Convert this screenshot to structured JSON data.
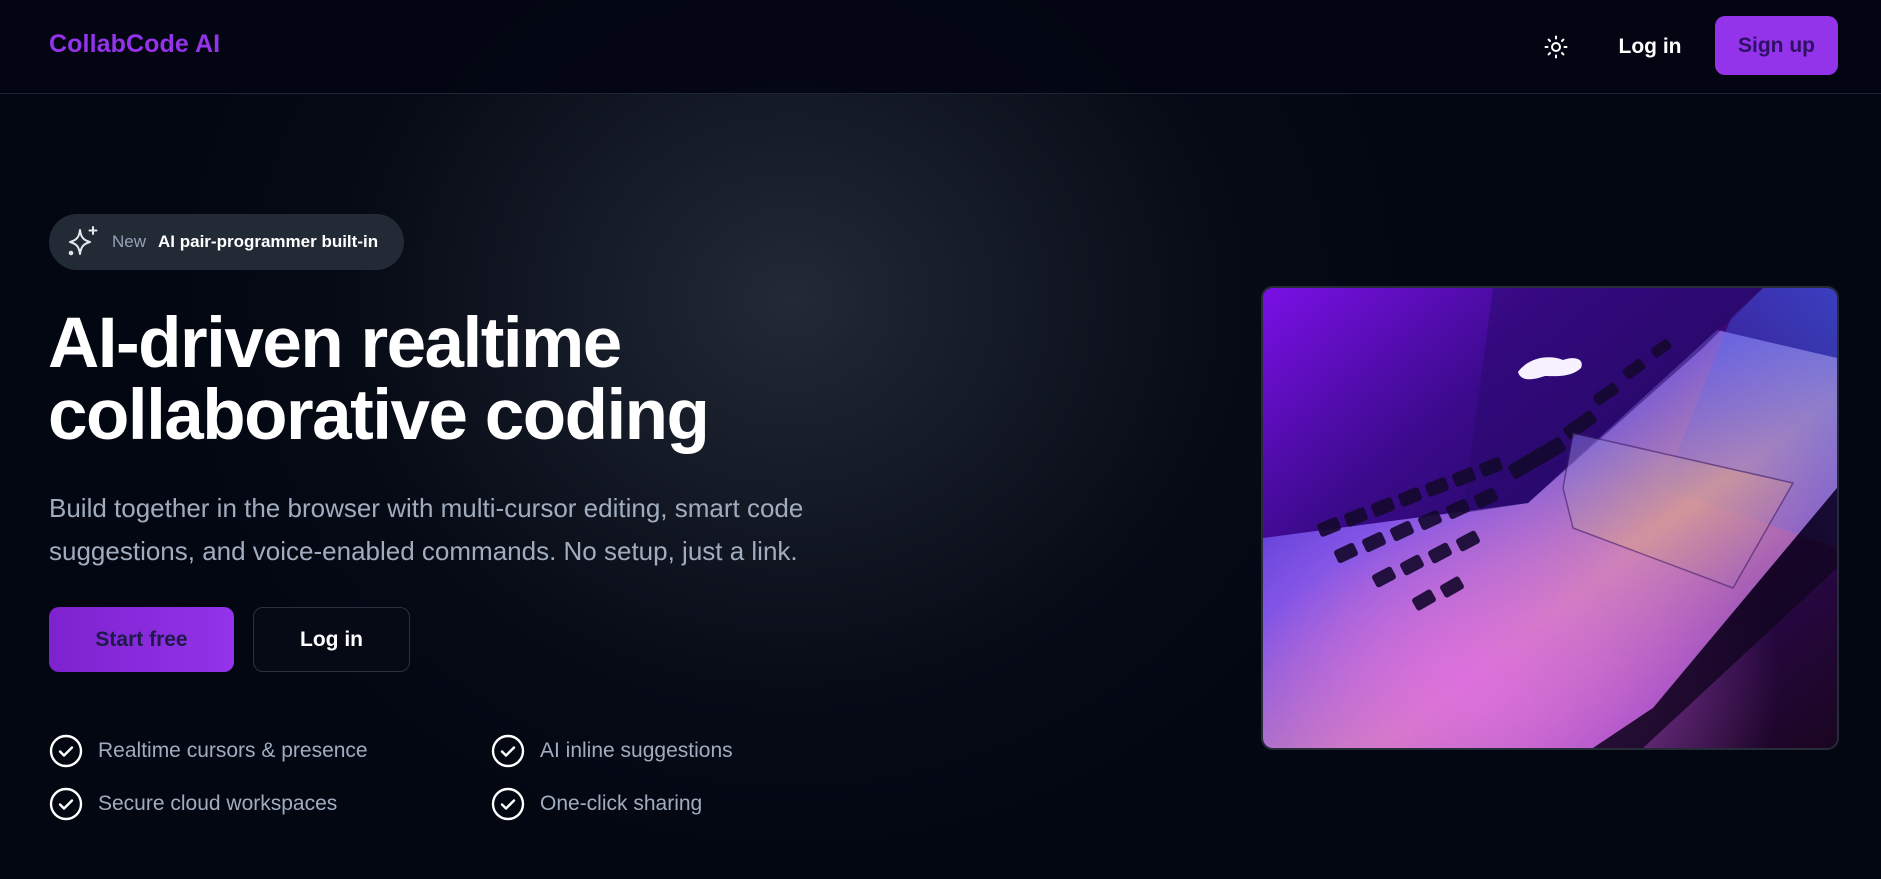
{
  "header": {
    "brand": "CollabCode AI",
    "theme_icon": "sun-icon",
    "login_label": "Log in",
    "signup_label": "Sign up"
  },
  "hero": {
    "badge": {
      "icon": "sparkles-icon",
      "tag": "New",
      "text": "AI pair-programmer built-in"
    },
    "headline_line1": "AI-driven realtime",
    "headline_line2": "collaborative coding",
    "subtext_line1": "Build together in the browser with multi-cursor editing, smart code",
    "subtext_line2": "suggestions, and voice-enabled commands. No setup, just a link.",
    "primary_cta": "Start free",
    "secondary_cta": "Log in",
    "features": [
      "Realtime cursors & presence",
      "AI inline suggestions",
      "Secure cloud workspaces",
      "One-click sharing"
    ],
    "image_subject": "laptop-photo"
  },
  "colors": {
    "accent": "#9333ea",
    "background": "#030712",
    "muted_text": "#a1adbf"
  }
}
